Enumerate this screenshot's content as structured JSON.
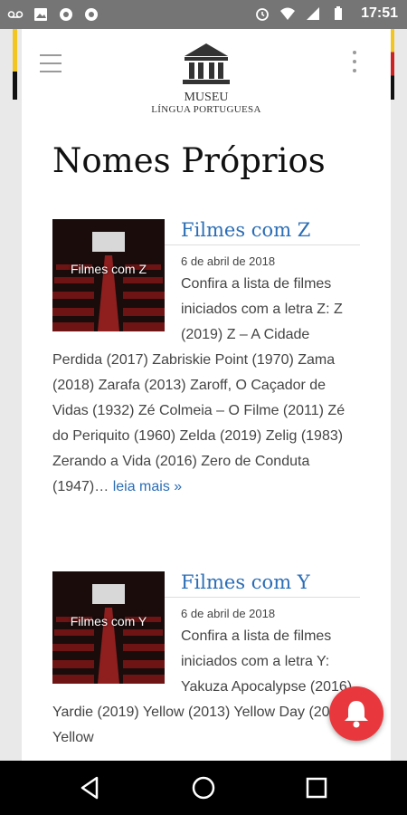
{
  "status": {
    "time": "17:51",
    "left_icons": [
      "voicemail-icon",
      "image-icon",
      "chrome-icon",
      "chrome-icon"
    ],
    "right_icons": [
      "alarm-icon",
      "wifi-icon",
      "signal-icon",
      "battery-icon"
    ]
  },
  "header": {
    "logo_line1": "MUSEU",
    "logo_line2": "LÍNGUA PORTUGUESA"
  },
  "page": {
    "title": "Nomes Próprios"
  },
  "posts": [
    {
      "title": "Filmes com Z",
      "thumb_caption": "Filmes com Z",
      "date": "6 de abril de 2018",
      "excerpt": "Confira a lista de filmes iniciados com a letra Z:   Z (2019) Z – A Cidade Perdida (2017) Zabriskie Point (1970) Zama (2018) Zarafa (2013) Zaroff, O Caçador de Vidas (1932)   Zé Colmeia – O Filme (2011) Zé do Periquito (1960) Zelda (2019) Zelig (1983) Zerando a Vida (2016) Zero de Conduta (1947)…",
      "more": "leia mais »"
    },
    {
      "title": "Filmes com Y",
      "thumb_caption": "Filmes com Y",
      "date": "6 de abril de 2018",
      "excerpt": "Confira a lista de filmes iniciados com a letra Y:   Yakuza Apocalypse (2016) Yardie (2019) Yellow (2013) Yellow Day (2017) Yellow",
      "more": ""
    }
  ],
  "colors": {
    "link": "#2a6db5",
    "fab": "#e8383d",
    "statusbar": "#757575"
  }
}
